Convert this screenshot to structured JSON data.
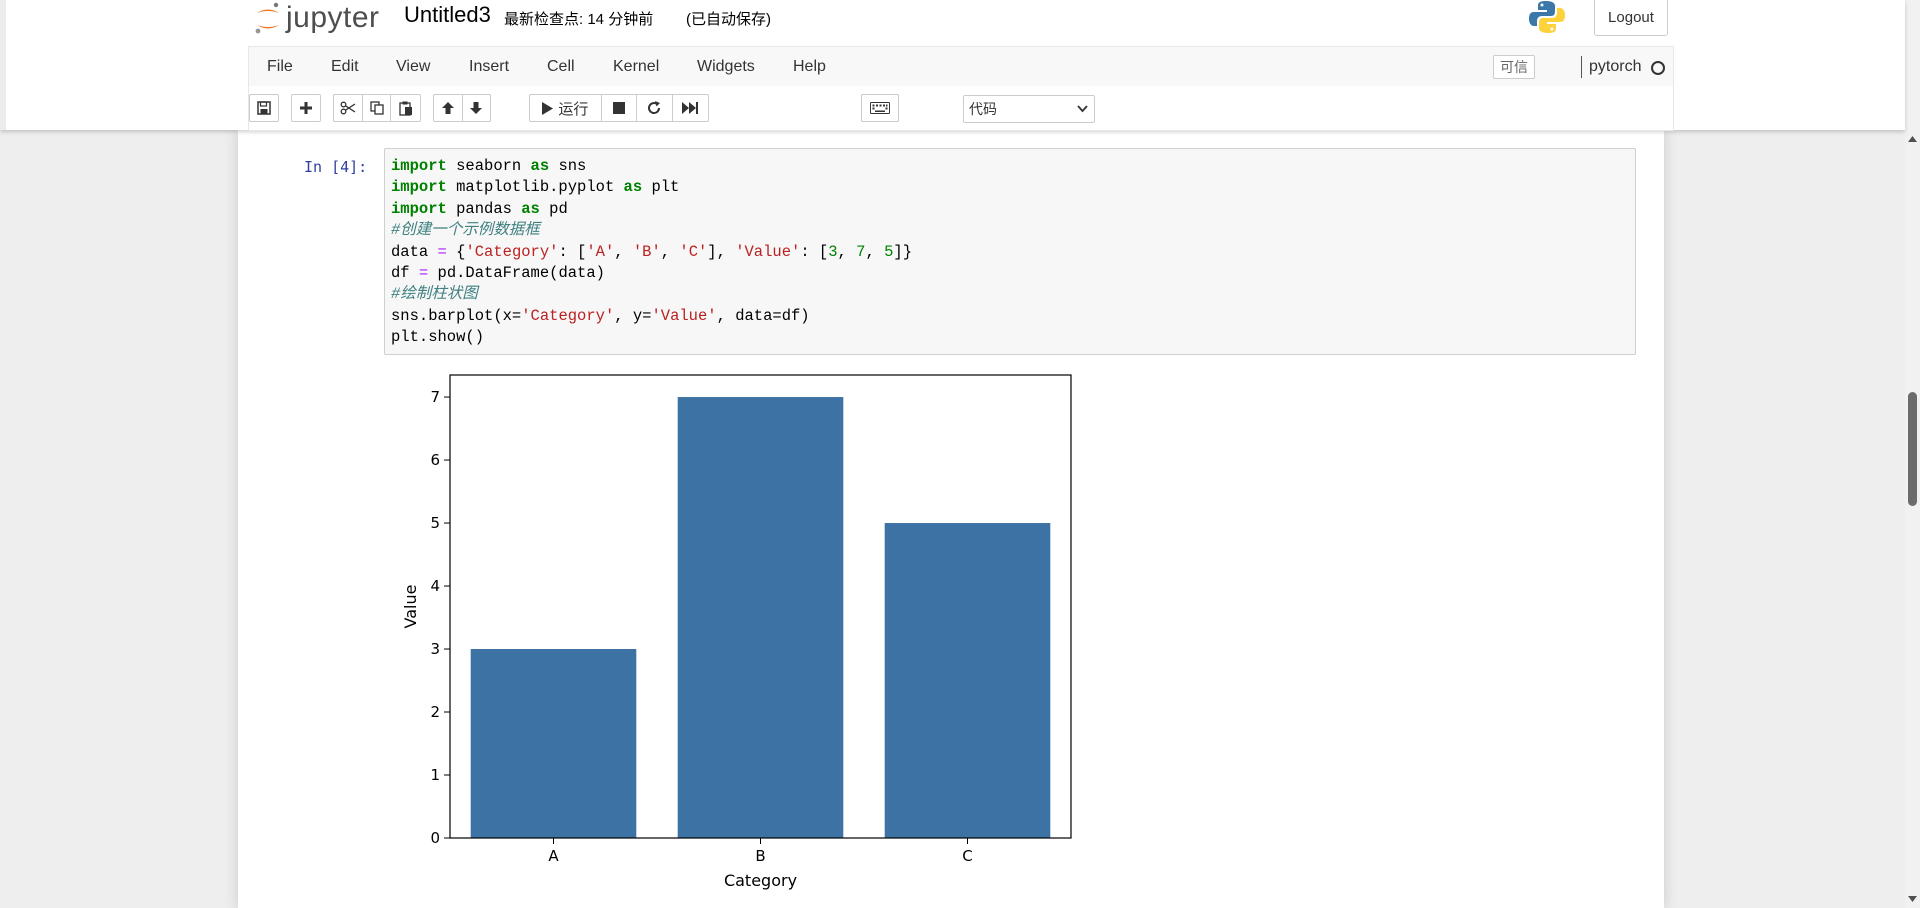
{
  "header": {
    "logo_text": "jupyter",
    "notebook_title": "Untitled3",
    "checkpoint": "最新检查点: 14 分钟前",
    "autosave": "(已自动保存)",
    "logout_label": "Logout"
  },
  "menubar": {
    "items": [
      "File",
      "Edit",
      "View",
      "Insert",
      "Cell",
      "Kernel",
      "Widgets",
      "Help"
    ],
    "trusted": "可信",
    "kernel_name": "pytorch"
  },
  "toolbar": {
    "run_label": "运行",
    "cell_type": "代码"
  },
  "cell": {
    "prompt": "In  [4]:",
    "code_lines": [
      "import seaborn as sns",
      "import matplotlib.pyplot as plt",
      "import pandas as pd",
      "#创建一个示例数据框",
      "data = {'Category': ['A', 'B', 'C'], 'Value': [3, 7, 5]}",
      "df = pd.DataFrame(data)",
      "#绘制柱状图",
      "sns.barplot(x='Category', y='Value', data=df)",
      "plt.show()"
    ]
  },
  "chart_data": {
    "type": "bar",
    "categories": [
      "A",
      "B",
      "C"
    ],
    "values": [
      3,
      7,
      5
    ],
    "title": "",
    "xlabel": "Category",
    "ylabel": "Value",
    "ylim": [
      0,
      7.35
    ],
    "yticks": [
      0,
      1,
      2,
      3,
      4,
      5,
      6,
      7
    ],
    "grid": false,
    "bar_color": "#3d72a4"
  },
  "colors": {
    "prompt": "#303f9f",
    "keyword": "#008000",
    "string": "#ba2121",
    "comment": "#408080",
    "operator": "#aa22ff"
  }
}
